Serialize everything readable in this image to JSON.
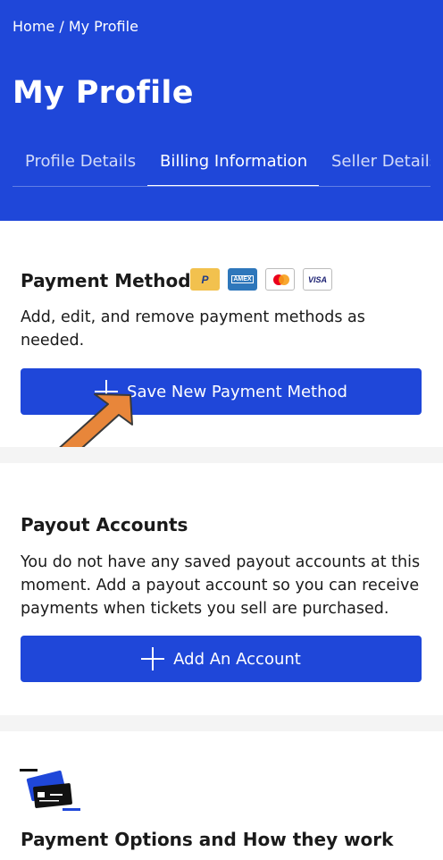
{
  "header": {
    "breadcrumb": "Home / My Profile",
    "title": "My Profile",
    "tabs": [
      {
        "label": "Profile Details",
        "active": false
      },
      {
        "label": "Billing Information",
        "active": true
      },
      {
        "label": "Seller Details",
        "active": false
      }
    ]
  },
  "payment_methods": {
    "title": "Payment Methods",
    "card_logos": [
      {
        "name": "paypal-icon",
        "label": "P"
      },
      {
        "name": "amex-icon",
        "label": "AMEX"
      },
      {
        "name": "mastercard-icon",
        "label": ""
      },
      {
        "name": "visa-icon",
        "label": "VISA"
      }
    ],
    "description": "Add, edit, and remove payment methods as needed.",
    "button_label": "Save New Payment Method"
  },
  "payout_accounts": {
    "title": "Payout Accounts",
    "description": "You do not have any saved payout accounts at this moment. Add a payout account so you can receive payments when tickets you sell are purchased.",
    "button_label": "Add An Account"
  },
  "payment_options": {
    "icon": "credit-card-illustration-icon",
    "title": "Payment Options and How they work"
  },
  "colors": {
    "brand_blue": "#1f47d9",
    "arrow_orange": "#e8863a",
    "divider_gray": "#f4f4f4"
  }
}
